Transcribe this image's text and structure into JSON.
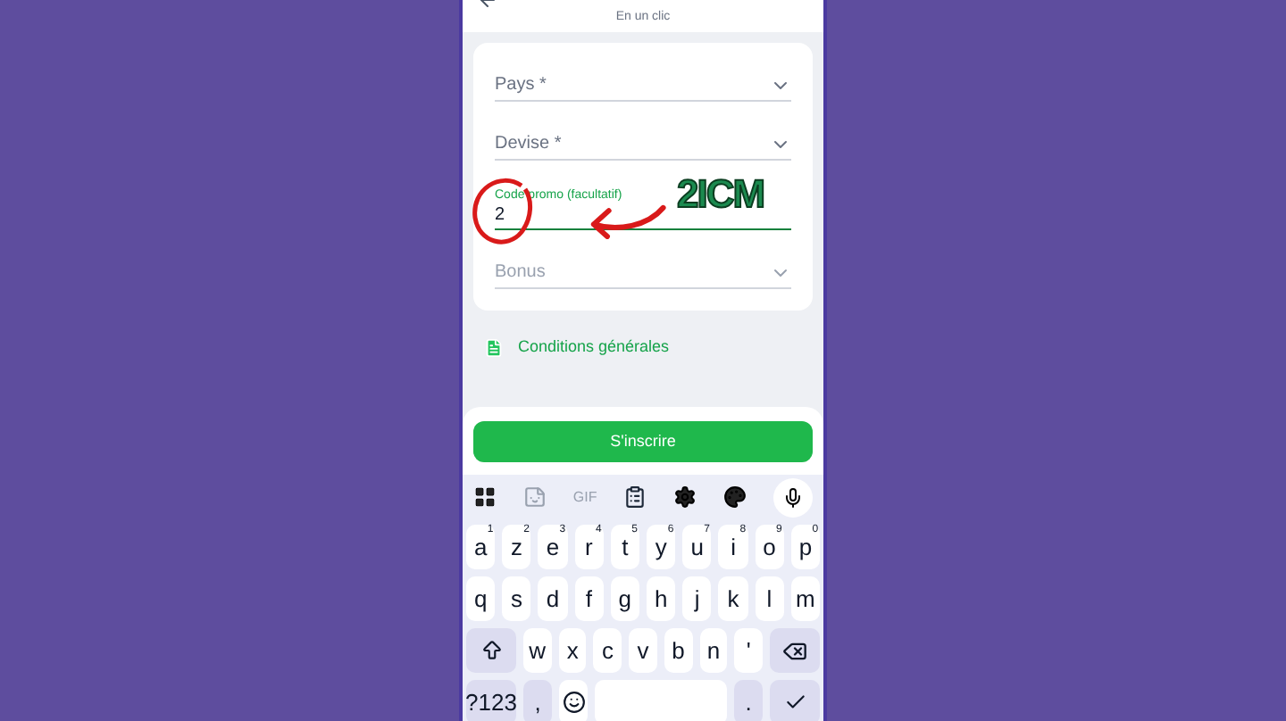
{
  "header": {
    "subtitle": "En un clic"
  },
  "fields": [
    {
      "kind": "select",
      "label": "Pays *",
      "disabled": false,
      "focused": false
    },
    {
      "kind": "select",
      "label": "Devise *",
      "disabled": false,
      "focused": false
    },
    {
      "kind": "text",
      "label": "Code promo (facultatif)",
      "value": "2",
      "disabled": false,
      "focused": true
    },
    {
      "kind": "select",
      "label": "Bonus",
      "disabled": true,
      "focused": false
    }
  ],
  "links": [
    {
      "label": "Conditions générales"
    }
  ],
  "submit": {
    "label": "S'inscrire"
  },
  "overlay": {
    "text": "2ICM"
  },
  "keyboard": {
    "toolbar": [
      {
        "kind": "grid"
      },
      {
        "kind": "sticker"
      },
      {
        "kind": "gif",
        "label": "GIF"
      },
      {
        "kind": "clipboard"
      },
      {
        "kind": "settings"
      },
      {
        "kind": "palette"
      },
      {
        "kind": "mic"
      }
    ],
    "rows": [
      [
        {
          "label": "a",
          "hint": "1"
        },
        {
          "label": "z",
          "hint": "2"
        },
        {
          "label": "e",
          "hint": "3"
        },
        {
          "label": "r",
          "hint": "4"
        },
        {
          "label": "t",
          "hint": "5"
        },
        {
          "label": "y",
          "hint": "6"
        },
        {
          "label": "u",
          "hint": "7"
        },
        {
          "label": "i",
          "hint": "8"
        },
        {
          "label": "o",
          "hint": "9"
        },
        {
          "label": "p",
          "hint": "0"
        }
      ],
      [
        {
          "label": "q"
        },
        {
          "label": "s"
        },
        {
          "label": "d"
        },
        {
          "label": "f"
        },
        {
          "label": "g"
        },
        {
          "label": "h"
        },
        {
          "label": "j"
        },
        {
          "label": "k"
        },
        {
          "label": "l"
        },
        {
          "label": "m"
        }
      ],
      [
        {
          "kind": "shift"
        },
        {
          "label": "w"
        },
        {
          "label": "x"
        },
        {
          "label": "c"
        },
        {
          "label": "v"
        },
        {
          "label": "b"
        },
        {
          "label": "n"
        },
        {
          "label": "'"
        },
        {
          "kind": "backspace"
        }
      ],
      [
        {
          "kind": "mode",
          "label": "?123"
        },
        {
          "kind": "punct",
          "label": ","
        },
        {
          "kind": "emoji"
        },
        {
          "kind": "space"
        },
        {
          "kind": "punct",
          "label": "."
        },
        {
          "kind": "enter"
        }
      ]
    ]
  }
}
